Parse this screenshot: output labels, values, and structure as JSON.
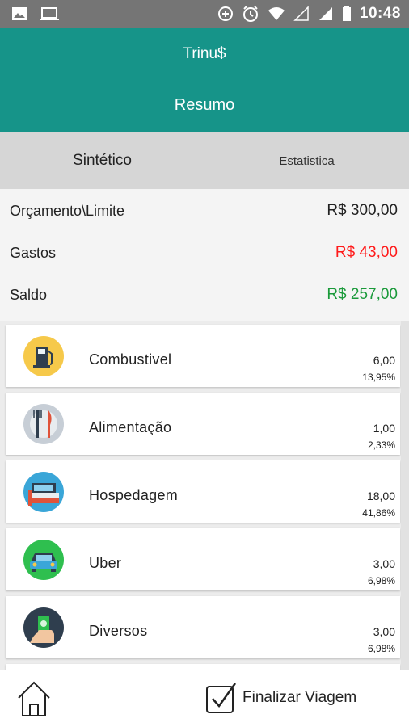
{
  "status_bar": {
    "time": "10:48"
  },
  "app": {
    "title": "Trinu$",
    "subtitle": "Resumo"
  },
  "tabs": [
    {
      "label": "Sintético",
      "active": true
    },
    {
      "label": "Estatistica",
      "active": false
    }
  ],
  "summary": {
    "budget_label": "Orçamento\\Limite",
    "budget_value": "R$ 300,00",
    "expenses_label": "Gastos",
    "expenses_value": "R$ 43,00",
    "balance_label": "Saldo",
    "balance_value": "R$ 257,00",
    "colors": {
      "expenses": "#ff1a1a",
      "balance": "#1a9a3a"
    }
  },
  "categories": [
    {
      "name": "Combustivel",
      "amount": "6,00",
      "percent": "13,95%",
      "icon": "fuel-pump-icon"
    },
    {
      "name": "Alimentação",
      "amount": "1,00",
      "percent": "2,33%",
      "icon": "cutlery-icon"
    },
    {
      "name": "Hospedagem",
      "amount": "18,00",
      "percent": "41,86%",
      "icon": "bed-icon"
    },
    {
      "name": "Uber",
      "amount": "3,00",
      "percent": "6,98%",
      "icon": "car-icon"
    },
    {
      "name": "Diversos",
      "amount": "3,00",
      "percent": "6,98%",
      "icon": "money-hand-icon"
    }
  ],
  "bottom_bar": {
    "finish_label": "Finalizar Viagem"
  },
  "colors": {
    "accent": "#169489",
    "status_bar": "#757575"
  }
}
